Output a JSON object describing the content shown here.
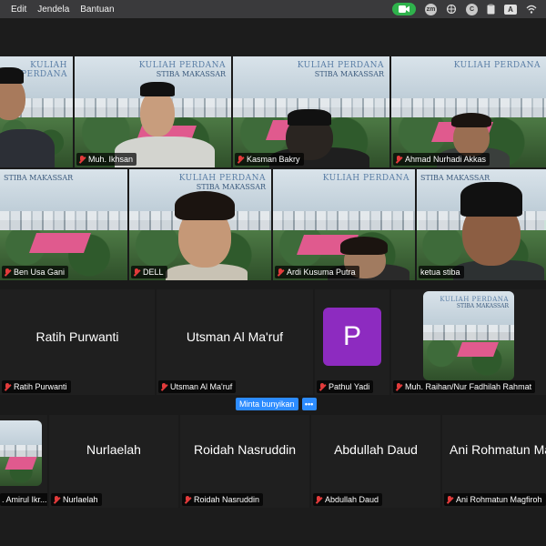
{
  "menubar": {
    "items": [
      "Edit",
      "Jendela",
      "Bantuan"
    ],
    "tray": {
      "badge_circle": "zm",
      "badge_c": "C",
      "badge_a": "A"
    }
  },
  "banner": {
    "line1": "KULIAH PERDANA",
    "line2": "STIBA MAKASSAR"
  },
  "participants_row1": [
    {
      "name": ""
    },
    {
      "name": "Muh. Ikhsan"
    },
    {
      "name": "Kasman Bakry"
    },
    {
      "name": "Ahmad Nurhadi Akkas"
    }
  ],
  "participants_row2": [
    {
      "name": "Ben Usa Gani"
    },
    {
      "name": "DELL"
    },
    {
      "name": "Ardi Kusuma Putra"
    },
    {
      "name": "ketua stiba"
    }
  ],
  "participants_row3": [
    {
      "display": "Ratih Purwanti",
      "name": "Ratih Purwanti"
    },
    {
      "display": "Utsman Al Ma'ruf",
      "name": "Utsman Al Ma'ruf"
    },
    {
      "avatar_letter": "P",
      "name": "Pathul Yadi"
    },
    {
      "name": "Muh. Raihan/Nur Fadhilah Rahmat"
    }
  ],
  "participants_row4": [
    {
      "name": ". Amirul Ikr..."
    },
    {
      "display": "Nurlaelah",
      "name": "Nurlaelah"
    },
    {
      "display": "Roidah Nasruddin",
      "name": "Roidah Nasruddin"
    },
    {
      "display": "Abdullah Daud",
      "name": "Abdullah Daud"
    },
    {
      "display": "Ani Rohmatun Mag",
      "name": "Ani Rohmatun Magfiroh"
    }
  ],
  "controls": {
    "unmute_label": "Minta bunyikan",
    "more_label": "•••"
  },
  "colors": {
    "active_border": "#2dc34f",
    "avatar_purple": "#8d2bc0",
    "mute_red": "#e23b3b",
    "button_blue": "#2d8cff"
  }
}
